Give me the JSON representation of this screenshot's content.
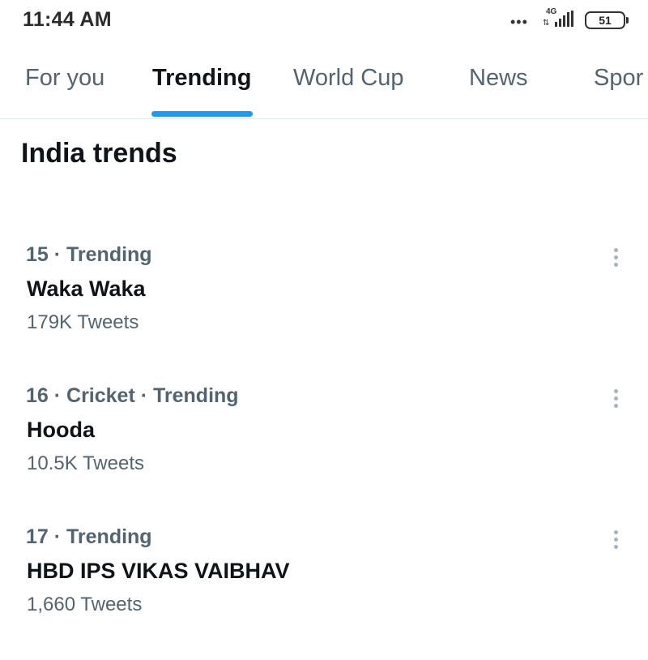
{
  "status_bar": {
    "time": "11:44 AM",
    "dots": "•••",
    "network": "4G",
    "battery": "51"
  },
  "tabs": [
    {
      "label": "For you",
      "active": false
    },
    {
      "label": "Trending",
      "active": true
    },
    {
      "label": "World Cup",
      "active": false
    },
    {
      "label": "News",
      "active": false
    },
    {
      "label": "Spor",
      "active": false
    }
  ],
  "section": {
    "title": "India trends"
  },
  "trends": [
    {
      "meta": "15 · Trending",
      "name": "Waka Waka",
      "count": "179K Tweets"
    },
    {
      "meta": "16 · Cricket · Trending",
      "name": "Hooda",
      "count": "10.5K Tweets"
    },
    {
      "meta": "17 · Trending",
      "name": "HBD IPS VIKAS VAIBHAV",
      "count": "1,660 Tweets"
    }
  ],
  "colors": {
    "accent": "#1d9bf0",
    "secondary_text": "#536471",
    "primary_text": "#0f1419"
  }
}
